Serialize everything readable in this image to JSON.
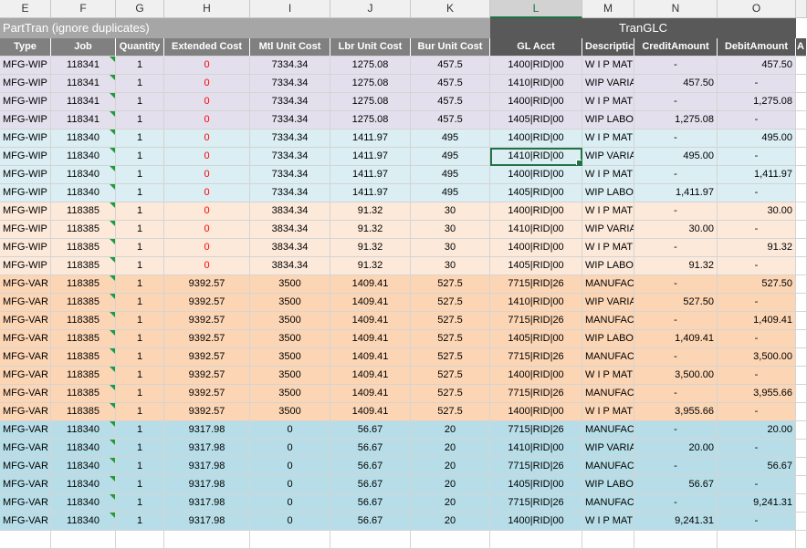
{
  "columns": [
    "E",
    "F",
    "G",
    "H",
    "I",
    "J",
    "K",
    "L",
    "M",
    "N",
    "O"
  ],
  "selected_column": "L",
  "groups": {
    "parttran": "PartTran (ignore duplicates)",
    "tranglc": "TranGLC"
  },
  "headers": {
    "type": "Type",
    "job": "Job",
    "quantity": "Quantity",
    "extended_cost": "Extended Cost",
    "mtl_unit_cost": "Mtl Unit Cost",
    "lbr_unit_cost": "Lbr Unit Cost",
    "bur_unit_cost": "Bur Unit Cost",
    "gl_acct": "GL Acct",
    "description": "Descriptic",
    "credit_amount": "CreditAmount",
    "debit_amount": "DebitAmount",
    "overflow": "A"
  },
  "colors": {
    "lavender": "#e4dfec",
    "light_blue": "#daeef3",
    "peach": "#fde9d9",
    "orange": "#fcd5b4",
    "teal": "#b7dee8",
    "header_gray": "#808080",
    "header_dark": "#595959",
    "selection_green": "#217346",
    "negative_red": "#ff0000"
  },
  "rows": [
    {
      "group": "lav",
      "type": "MFG-WIP",
      "job": "118341",
      "qty": "1",
      "ext": "0",
      "mtl": "7334.34",
      "lbr": "1275.08",
      "bur": "457.5",
      "gl": "1400|RID|00",
      "desc": "W I P MATE",
      "credit": "-",
      "debit": "457.50"
    },
    {
      "group": "lav",
      "type": "MFG-WIP",
      "job": "118341",
      "qty": "1",
      "ext": "0",
      "mtl": "7334.34",
      "lbr": "1275.08",
      "bur": "457.5",
      "gl": "1410|RID|00",
      "desc": "WIP VARIA",
      "credit": "457.50",
      "debit": "-"
    },
    {
      "group": "lav",
      "type": "MFG-WIP",
      "job": "118341",
      "qty": "1",
      "ext": "0",
      "mtl": "7334.34",
      "lbr": "1275.08",
      "bur": "457.5",
      "gl": "1400|RID|00",
      "desc": "W I P MATE",
      "credit": "-",
      "debit": "1,275.08"
    },
    {
      "group": "lav",
      "type": "MFG-WIP",
      "job": "118341",
      "qty": "1",
      "ext": "0",
      "mtl": "7334.34",
      "lbr": "1275.08",
      "bur": "457.5",
      "gl": "1405|RID|00",
      "desc": "WIP LABOR",
      "credit": "1,275.08",
      "debit": "-"
    },
    {
      "group": "blue",
      "type": "MFG-WIP",
      "job": "118340",
      "qty": "1",
      "ext": "0",
      "mtl": "7334.34",
      "lbr": "1411.97",
      "bur": "495",
      "gl": "1400|RID|00",
      "desc": "W I P MATE",
      "credit": "-",
      "debit": "495.00"
    },
    {
      "group": "blue",
      "type": "MFG-WIP",
      "job": "118340",
      "qty": "1",
      "ext": "0",
      "mtl": "7334.34",
      "lbr": "1411.97",
      "bur": "495",
      "gl": "1410|RID|00",
      "desc": "WIP VARIA",
      "credit": "495.00",
      "debit": "-",
      "active": true
    },
    {
      "group": "blue",
      "type": "MFG-WIP",
      "job": "118340",
      "qty": "1",
      "ext": "0",
      "mtl": "7334.34",
      "lbr": "1411.97",
      "bur": "495",
      "gl": "1400|RID|00",
      "desc": "W I P MATE",
      "credit": "-",
      "debit": "1,411.97"
    },
    {
      "group": "blue",
      "type": "MFG-WIP",
      "job": "118340",
      "qty": "1",
      "ext": "0",
      "mtl": "7334.34",
      "lbr": "1411.97",
      "bur": "495",
      "gl": "1405|RID|00",
      "desc": "WIP LABOR",
      "credit": "1,411.97",
      "debit": "-"
    },
    {
      "group": "peach",
      "type": "MFG-WIP",
      "job": "118385",
      "qty": "1",
      "ext": "0",
      "mtl": "3834.34",
      "lbr": "91.32",
      "bur": "30",
      "gl": "1400|RID|00",
      "desc": "W I P MATE",
      "credit": "-",
      "debit": "30.00"
    },
    {
      "group": "peach",
      "type": "MFG-WIP",
      "job": "118385",
      "qty": "1",
      "ext": "0",
      "mtl": "3834.34",
      "lbr": "91.32",
      "bur": "30",
      "gl": "1410|RID|00",
      "desc": "WIP VARIA",
      "credit": "30.00",
      "debit": "-"
    },
    {
      "group": "peach",
      "type": "MFG-WIP",
      "job": "118385",
      "qty": "1",
      "ext": "0",
      "mtl": "3834.34",
      "lbr": "91.32",
      "bur": "30",
      "gl": "1400|RID|00",
      "desc": "W I P MATE",
      "credit": "-",
      "debit": "91.32"
    },
    {
      "group": "peach",
      "type": "MFG-WIP",
      "job": "118385",
      "qty": "1",
      "ext": "0",
      "mtl": "3834.34",
      "lbr": "91.32",
      "bur": "30",
      "gl": "1405|RID|00",
      "desc": "WIP LABOR",
      "credit": "91.32",
      "debit": "-"
    },
    {
      "group": "orange",
      "type": "MFG-VAR",
      "job": "118385",
      "qty": "1",
      "ext": "9392.57",
      "mtl": "3500",
      "lbr": "1409.41",
      "bur": "527.5",
      "gl": "7715|RID|26",
      "desc": "MANUFACT",
      "credit": "-",
      "debit": "527.50"
    },
    {
      "group": "orange",
      "type": "MFG-VAR",
      "job": "118385",
      "qty": "1",
      "ext": "9392.57",
      "mtl": "3500",
      "lbr": "1409.41",
      "bur": "527.5",
      "gl": "1410|RID|00",
      "desc": "WIP VARIA",
      "credit": "527.50",
      "debit": "-"
    },
    {
      "group": "orange",
      "type": "MFG-VAR",
      "job": "118385",
      "qty": "1",
      "ext": "9392.57",
      "mtl": "3500",
      "lbr": "1409.41",
      "bur": "527.5",
      "gl": "7715|RID|26",
      "desc": "MANUFACT",
      "credit": "-",
      "debit": "1,409.41"
    },
    {
      "group": "orange",
      "type": "MFG-VAR",
      "job": "118385",
      "qty": "1",
      "ext": "9392.57",
      "mtl": "3500",
      "lbr": "1409.41",
      "bur": "527.5",
      "gl": "1405|RID|00",
      "desc": "WIP LABOR",
      "credit": "1,409.41",
      "debit": "-"
    },
    {
      "group": "orange",
      "type": "MFG-VAR",
      "job": "118385",
      "qty": "1",
      "ext": "9392.57",
      "mtl": "3500",
      "lbr": "1409.41",
      "bur": "527.5",
      "gl": "7715|RID|26",
      "desc": "MANUFACT",
      "credit": "-",
      "debit": "3,500.00"
    },
    {
      "group": "orange",
      "type": "MFG-VAR",
      "job": "118385",
      "qty": "1",
      "ext": "9392.57",
      "mtl": "3500",
      "lbr": "1409.41",
      "bur": "527.5",
      "gl": "1400|RID|00",
      "desc": "W I P MATE",
      "credit": "3,500.00",
      "debit": "-"
    },
    {
      "group": "orange",
      "type": "MFG-VAR",
      "job": "118385",
      "qty": "1",
      "ext": "9392.57",
      "mtl": "3500",
      "lbr": "1409.41",
      "bur": "527.5",
      "gl": "7715|RID|26",
      "desc": "MANUFACT",
      "credit": "-",
      "debit": "3,955.66"
    },
    {
      "group": "orange",
      "type": "MFG-VAR",
      "job": "118385",
      "qty": "1",
      "ext": "9392.57",
      "mtl": "3500",
      "lbr": "1409.41",
      "bur": "527.5",
      "gl": "1400|RID|00",
      "desc": "W I P MATE",
      "credit": "3,955.66",
      "debit": "-"
    },
    {
      "group": "teal",
      "type": "MFG-VAR",
      "job": "118340",
      "qty": "1",
      "ext": "9317.98",
      "mtl": "0",
      "lbr": "56.67",
      "bur": "20",
      "gl": "7715|RID|26",
      "desc": "MANUFACT",
      "credit": "-",
      "debit": "20.00"
    },
    {
      "group": "teal",
      "type": "MFG-VAR",
      "job": "118340",
      "qty": "1",
      "ext": "9317.98",
      "mtl": "0",
      "lbr": "56.67",
      "bur": "20",
      "gl": "1410|RID|00",
      "desc": "WIP VARIA",
      "credit": "20.00",
      "debit": "-"
    },
    {
      "group": "teal",
      "type": "MFG-VAR",
      "job": "118340",
      "qty": "1",
      "ext": "9317.98",
      "mtl": "0",
      "lbr": "56.67",
      "bur": "20",
      "gl": "7715|RID|26",
      "desc": "MANUFACT",
      "credit": "-",
      "debit": "56.67"
    },
    {
      "group": "teal",
      "type": "MFG-VAR",
      "job": "118340",
      "qty": "1",
      "ext": "9317.98",
      "mtl": "0",
      "lbr": "56.67",
      "bur": "20",
      "gl": "1405|RID|00",
      "desc": "WIP LABOR",
      "credit": "56.67",
      "debit": "-"
    },
    {
      "group": "teal",
      "type": "MFG-VAR",
      "job": "118340",
      "qty": "1",
      "ext": "9317.98",
      "mtl": "0",
      "lbr": "56.67",
      "bur": "20",
      "gl": "7715|RID|26",
      "desc": "MANUFACT",
      "credit": "-",
      "debit": "9,241.31"
    },
    {
      "group": "teal",
      "type": "MFG-VAR",
      "job": "118340",
      "qty": "1",
      "ext": "9317.98",
      "mtl": "0",
      "lbr": "56.67",
      "bur": "20",
      "gl": "1400|RID|00",
      "desc": "W I P MATE",
      "credit": "9,241.31",
      "debit": "-"
    }
  ]
}
